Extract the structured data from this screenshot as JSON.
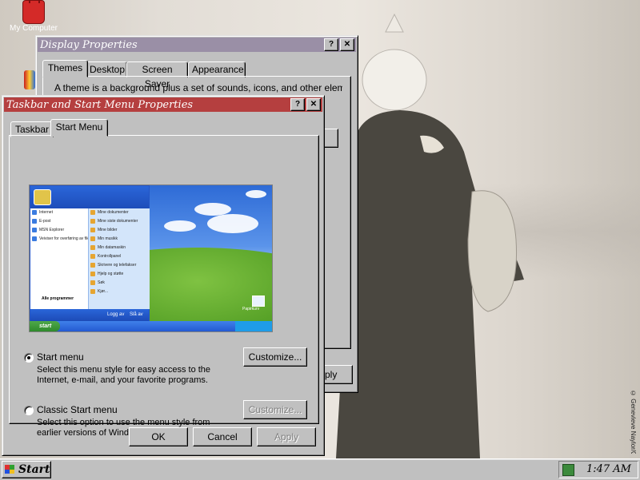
{
  "desktop": {
    "icons": [
      {
        "label": "My Computer"
      }
    ],
    "copyright": "© Genevieve Naylor/Cor"
  },
  "display_properties": {
    "title": "Display Properties",
    "tabs": [
      "Themes",
      "Desktop",
      "Screen Saver",
      "Appearance"
    ],
    "active_tab": "Themes",
    "description": "A theme is a background plus a set of sounds, icons, and other elements",
    "apply_fragment": "ply"
  },
  "taskbar_properties": {
    "title": "Taskbar and Start Menu Properties",
    "tabs": [
      "Taskbar",
      "Start Menu"
    ],
    "active_tab": "Start Menu",
    "preview": {
      "left_items": [
        "Internet",
        "E-post",
        "MSN Explorer",
        "Veiviser for overføring av filer og innstillinger"
      ],
      "right_items": [
        "Mine dokumenter",
        "Mine siste dokumenter",
        "Mine bilder",
        "Min musikk",
        "Min datamaskin",
        "Kontrollpanel",
        "Skrivere og telefakser",
        "Hjelp og støtte",
        "Søk",
        "Kjør..."
      ],
      "all_programs": "Alle programmer",
      "logoff": "Logg av",
      "shutdown": "Slå av",
      "start": "start",
      "recycle": "Papirkurv"
    },
    "options": [
      {
        "label": "Start menu",
        "checked": true,
        "description": "Select this menu style for easy access to the Internet, e-mail, and your favorite programs.",
        "button": "Customize...",
        "button_enabled": true
      },
      {
        "label": "Classic Start menu",
        "checked": false,
        "description": "Select this option to use the menu style from earlier versions of Windows.",
        "button": "Customize...",
        "button_enabled": false
      }
    ],
    "buttons": {
      "ok": "OK",
      "cancel": "Cancel",
      "apply": "Apply"
    }
  },
  "taskbar": {
    "start_label": "Start",
    "clock": "1:47 AM"
  }
}
